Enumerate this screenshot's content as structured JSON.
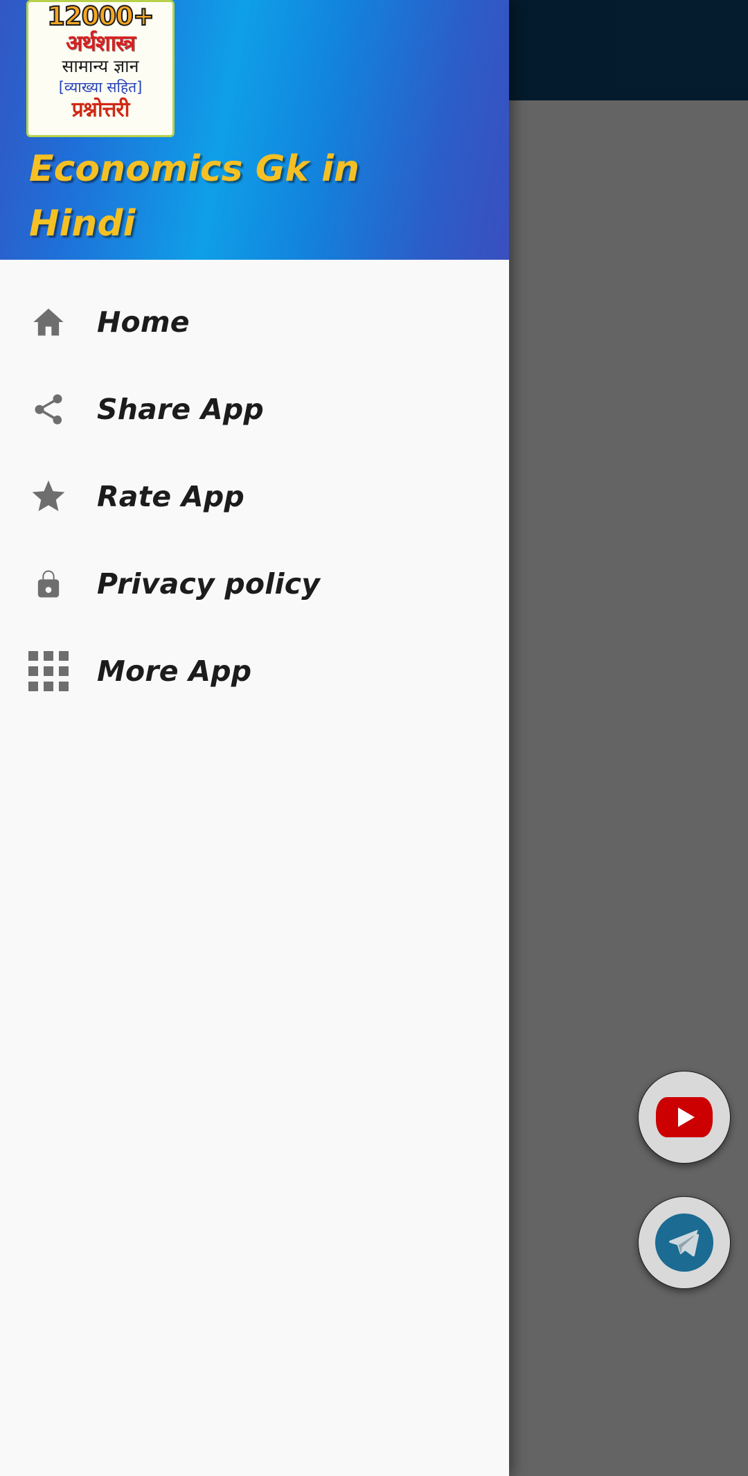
{
  "app": {
    "title": "Economics Gk in Hindi",
    "logo": {
      "name": "app-logo",
      "line1": "12000+",
      "line2": "अर्थशास्त्र",
      "line3": "सामान्य ज्ञान",
      "line4": "[व्याख्या सहित]",
      "line5": "प्रश्नोत्तरी"
    }
  },
  "colors": {
    "action_bar": "#0b4570",
    "drawer_gradient_start": "#3257c4",
    "drawer_gradient_mid": "#0f9fe8",
    "drawer_gradient_end": "#3a4fbf",
    "drawer_background": "#f9f9f9",
    "title_text": "#f5c024",
    "menu_text": "#1c1c1c",
    "menu_icon": "#6e6e6e",
    "scrim": "#666666",
    "youtube_red": "#cc0000",
    "telegram_blue": "#1b6b93",
    "fab_background": "#d9d9d9"
  },
  "drawer": {
    "items": [
      {
        "label": "Home",
        "icon": "home-icon"
      },
      {
        "label": "Share App",
        "icon": "share-icon"
      },
      {
        "label": "Rate App",
        "icon": "star-icon"
      },
      {
        "label": "Privacy policy",
        "icon": "lock-icon"
      },
      {
        "label": "More App",
        "icon": "grid-apps-icon"
      }
    ]
  },
  "fabs": [
    {
      "name": "youtube-fab",
      "icon": "youtube-icon"
    },
    {
      "name": "telegram-fab",
      "icon": "telegram-icon"
    }
  ]
}
